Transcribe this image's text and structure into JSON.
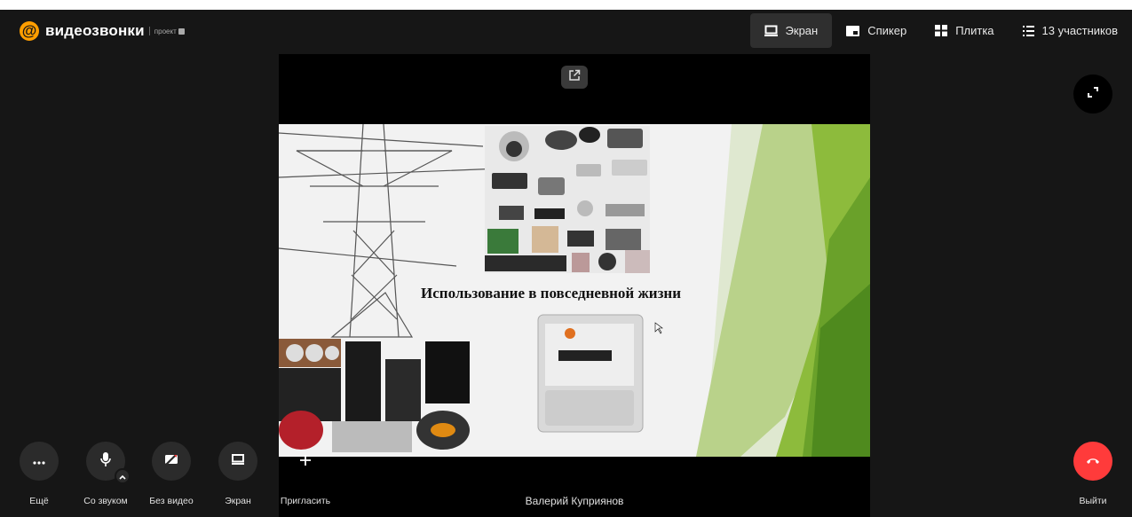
{
  "header": {
    "logo_symbol": "@",
    "logo_text": "видеозвонки",
    "logo_subtitle": "проект"
  },
  "view_modes": [
    {
      "label": "Экран",
      "icon": "screen-icon",
      "active": true
    },
    {
      "label": "Спикер",
      "icon": "speaker-icon",
      "active": false
    },
    {
      "label": "Плитка",
      "icon": "grid-icon",
      "active": false
    },
    {
      "label": "13 участников",
      "icon": "participants-list-icon",
      "active": false
    }
  ],
  "slide": {
    "title": "Использование в повседневной жизни"
  },
  "speaker": {
    "name": "Валерий Куприянов"
  },
  "controls": {
    "more_label": "Ещё",
    "sound_label": "Со звуком",
    "video_label": "Без видео",
    "screen_label": "Экран",
    "invite_label": "Пригласить",
    "leave_label": "Выйти"
  },
  "colors": {
    "accent_orange": "#ff9e00",
    "hangup_red": "#ff3b3b",
    "background": "#161616",
    "slide_green": "#8dbb3c"
  }
}
